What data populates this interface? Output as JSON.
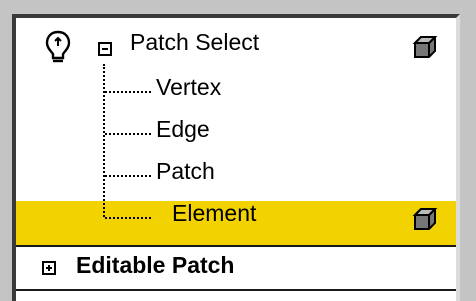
{
  "modifier_stack": {
    "patch_select": {
      "label": "Patch Select",
      "bulb_icon": "lightbulb-icon",
      "collapse_icon": "minus-box-icon",
      "object_icon": "cube-icon"
    },
    "sub_objects": [
      {
        "label": "Vertex"
      },
      {
        "label": "Edge"
      },
      {
        "label": "Patch"
      },
      {
        "label": "Element",
        "selected": true,
        "object_icon": "cube-icon"
      }
    ],
    "editable_patch": {
      "label": "Editable Patch",
      "expand_icon": "plus-box-icon"
    }
  },
  "colors": {
    "selection": "#f2d200",
    "panel_bg": "#ffffff",
    "chrome": "#c4c4c4"
  }
}
